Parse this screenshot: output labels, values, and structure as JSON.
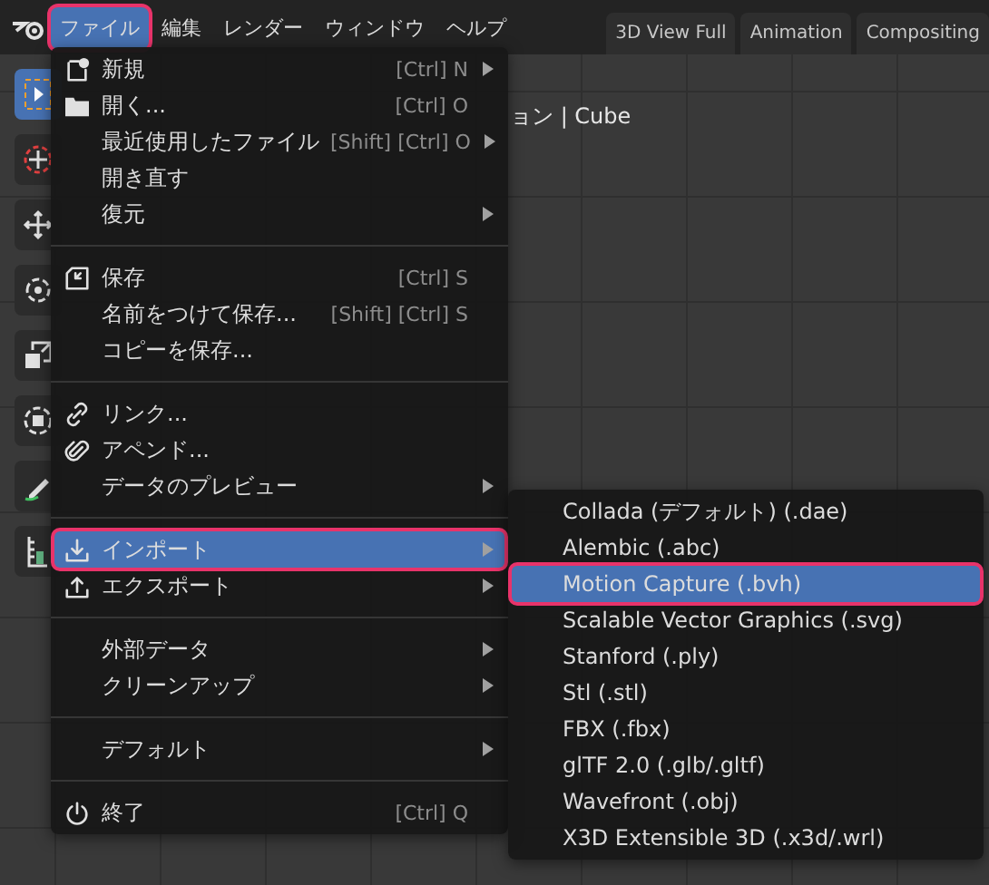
{
  "menubar": {
    "items": [
      {
        "label": "ファイル",
        "selected": true
      },
      {
        "label": "編集",
        "selected": false
      },
      {
        "label": "レンダー",
        "selected": false
      },
      {
        "label": "ウィンドウ",
        "selected": false
      },
      {
        "label": "ヘルプ",
        "selected": false
      }
    ]
  },
  "workspace_tabs": [
    {
      "label": "3D View Full"
    },
    {
      "label": "Animation"
    },
    {
      "label": "Compositing"
    }
  ],
  "viewport": {
    "overlay_text": "ョン | Cube",
    "tools": [
      {
        "kind": "select",
        "selected": true
      },
      {
        "kind": "cursor",
        "selected": false
      },
      {
        "kind": "move",
        "selected": false
      },
      {
        "kind": "rotate",
        "selected": false
      },
      {
        "kind": "scale",
        "selected": false
      },
      {
        "kind": "transform",
        "selected": false
      },
      {
        "kind": "annotate",
        "selected": false
      },
      {
        "kind": "measure",
        "selected": false
      }
    ]
  },
  "file_menu": {
    "items": [
      {
        "kind": "item",
        "label": "新規",
        "shortcut": "[Ctrl] N",
        "has_submenu": true,
        "selected": false
      },
      {
        "kind": "item",
        "label": "開く...",
        "shortcut": "[Ctrl] O",
        "has_submenu": false,
        "selected": false
      },
      {
        "kind": "item",
        "label": "最近使用したファイル",
        "shortcut": "[Shift] [Ctrl] O",
        "has_submenu": true,
        "selected": false
      },
      {
        "kind": "item",
        "label": "開き直す",
        "has_submenu": false,
        "selected": false
      },
      {
        "kind": "item",
        "label": "復元",
        "has_submenu": true,
        "selected": false
      },
      {
        "kind": "separator"
      },
      {
        "kind": "item",
        "label": "保存",
        "shortcut": "[Ctrl] S",
        "has_submenu": false,
        "selected": false
      },
      {
        "kind": "item",
        "label": "名前をつけて保存...",
        "shortcut": "[Shift] [Ctrl] S",
        "has_submenu": false,
        "selected": false
      },
      {
        "kind": "item",
        "label": "コピーを保存...",
        "has_submenu": false,
        "selected": false
      },
      {
        "kind": "separator"
      },
      {
        "kind": "item",
        "label": "リンク...",
        "has_submenu": false,
        "selected": false
      },
      {
        "kind": "item",
        "label": "アペンド...",
        "has_submenu": false,
        "selected": false
      },
      {
        "kind": "item",
        "label": "データのプレビュー",
        "has_submenu": true,
        "selected": false
      },
      {
        "kind": "separator"
      },
      {
        "kind": "item",
        "label": "インポート",
        "has_submenu": true,
        "selected": true
      },
      {
        "kind": "item",
        "label": "エクスポート",
        "has_submenu": true,
        "selected": false
      },
      {
        "kind": "separator"
      },
      {
        "kind": "item",
        "label": "外部データ",
        "has_submenu": true,
        "selected": false
      },
      {
        "kind": "item",
        "label": "クリーンアップ",
        "has_submenu": true,
        "selected": false
      },
      {
        "kind": "separator"
      },
      {
        "kind": "item",
        "label": "デフォルト",
        "has_submenu": true,
        "selected": false
      },
      {
        "kind": "separator"
      },
      {
        "kind": "item",
        "label": "終了",
        "shortcut": "[Ctrl] Q",
        "has_submenu": false,
        "selected": false
      }
    ]
  },
  "import_submenu": {
    "items": [
      {
        "label": "Collada (デフォルト) (.dae)",
        "selected": false
      },
      {
        "label": "Alembic (.abc)",
        "selected": false
      },
      {
        "label": "Motion Capture (.bvh)",
        "selected": true
      },
      {
        "label": "Scalable Vector Graphics (.svg)",
        "selected": false
      },
      {
        "label": "Stanford (.ply)",
        "selected": false
      },
      {
        "label": "Stl (.stl)",
        "selected": false
      },
      {
        "label": "FBX (.fbx)",
        "selected": false
      },
      {
        "label": "glTF 2.0 (.glb/.gltf)",
        "selected": false
      },
      {
        "label": "Wavefront (.obj)",
        "selected": false
      },
      {
        "label": "X3D Extensible 3D (.x3d/.wrl)",
        "selected": false
      }
    ]
  }
}
